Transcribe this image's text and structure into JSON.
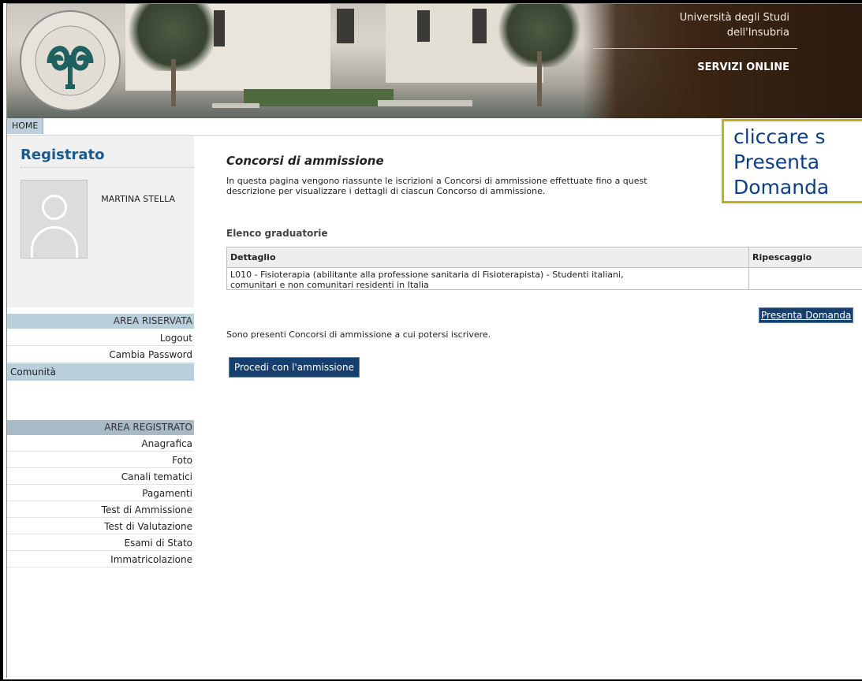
{
  "header": {
    "university_line1": "Università degli Studi",
    "university_line2": "dell'Insubria",
    "services": "SERVIZI ONLINE",
    "logo_icon": "insubria-seal-icon"
  },
  "nav": {
    "home": "HOME"
  },
  "sidebar": {
    "title": "Registrato",
    "user_name": "MARTINA STELLA",
    "avatar_icon": "user-placeholder-icon",
    "area_riservata": {
      "heading": "AREA RISERVATA",
      "items": [
        "Logout",
        "Cambia Password"
      ]
    },
    "comunita": "Comunità",
    "area_registrato": {
      "heading": "AREA REGISTRATO",
      "items": [
        "Anagrafica",
        "Foto",
        "Canali tematici",
        "Pagamenti",
        "Test di Ammissione",
        "Test di Valutazione",
        "Esami di Stato",
        "Immatricolazione"
      ]
    }
  },
  "main": {
    "title": "Concorsi di ammissione",
    "intro_line1": "In questa pagina vengono riassunte le iscrizioni a Concorsi di ammissione effettuate fino a quest",
    "intro_line2": "descrizione per visualizzare i dettagli di ciascun Concorso di ammissione.",
    "list_title": "Elenco graduatorie",
    "table": {
      "headers": [
        "Dettaglio",
        "Ripescaggio"
      ],
      "rows": [
        {
          "detail_line1": "L010 - Fisioterapia (abilitante alla professione sanitaria di Fisioterapista) - Studenti italiani,",
          "detail_line2": "comunitari e non comunitari residenti in Italia",
          "action": "Presenta Domanda"
        }
      ]
    },
    "available_text": "Sono presenti Concorsi di ammissione a cui potersi iscrivere.",
    "proceed_button": "Procedi con l'ammissione"
  },
  "callout": {
    "text": "cliccare s\nPresenta\nDomanda",
    "border_color": "#bfb01d",
    "text_color": "#0e3e86"
  },
  "colors": {
    "brand_blue": "#1b5a8b",
    "button_blue": "#163f6e",
    "section_blue": "#b9cfdc"
  }
}
